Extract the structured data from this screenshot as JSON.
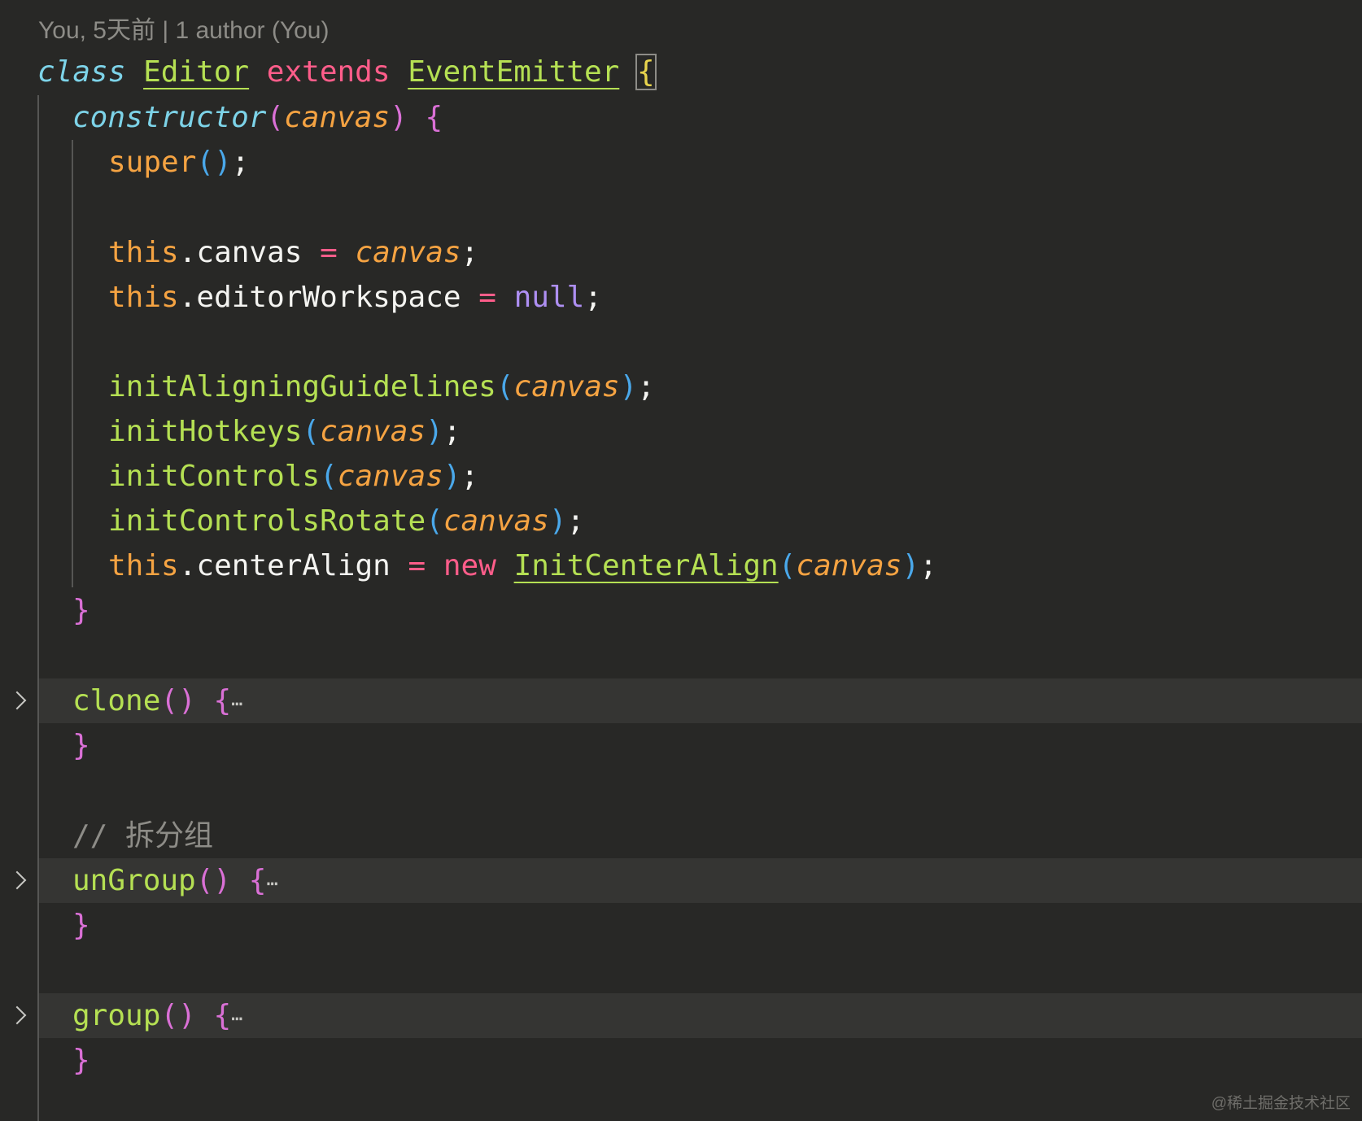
{
  "codelens": "You, 5天前 | 1 author (You)",
  "code": {
    "class_kw": "class",
    "class_name": "Editor",
    "extends_kw": "extends",
    "parent_class": "EventEmitter",
    "open_brace": "{",
    "close_brace": "}",
    "semicolon": ";",
    "dot": ".",
    "assign": "=",
    "open_paren": "(",
    "close_paren": ")",
    "ctor_kw": "constructor",
    "param": "canvas",
    "super_kw": "super",
    "this_kw": "this",
    "prop_canvas": "canvas",
    "prop_workspace": "editorWorkspace",
    "null_kw": "null",
    "call1": "initAligningGuidelines",
    "call2": "initHotkeys",
    "call3": "initControls",
    "call4": "initControlsRotate",
    "prop_center": "centerAlign",
    "new_kw": "new",
    "center_class": "InitCenterAlign",
    "fold_ellipsis": "⋯",
    "method_clone": "clone",
    "comment": "// 拆分组",
    "method_ungroup": "unGroup",
    "method_group": "group"
  },
  "watermark": "@稀土掘金技术社区",
  "colors": {
    "background": "#282826",
    "keyword": "#7dd3e8",
    "class": "#b5e053",
    "extends": "#ff5d8a",
    "param": "#f5a342",
    "null": "#ae8ff2",
    "bracket_yellow": "#e8d44d",
    "bracket_purple": "#da70d6",
    "bracket_blue": "#4aa8ea",
    "comment": "#8d8c87"
  }
}
